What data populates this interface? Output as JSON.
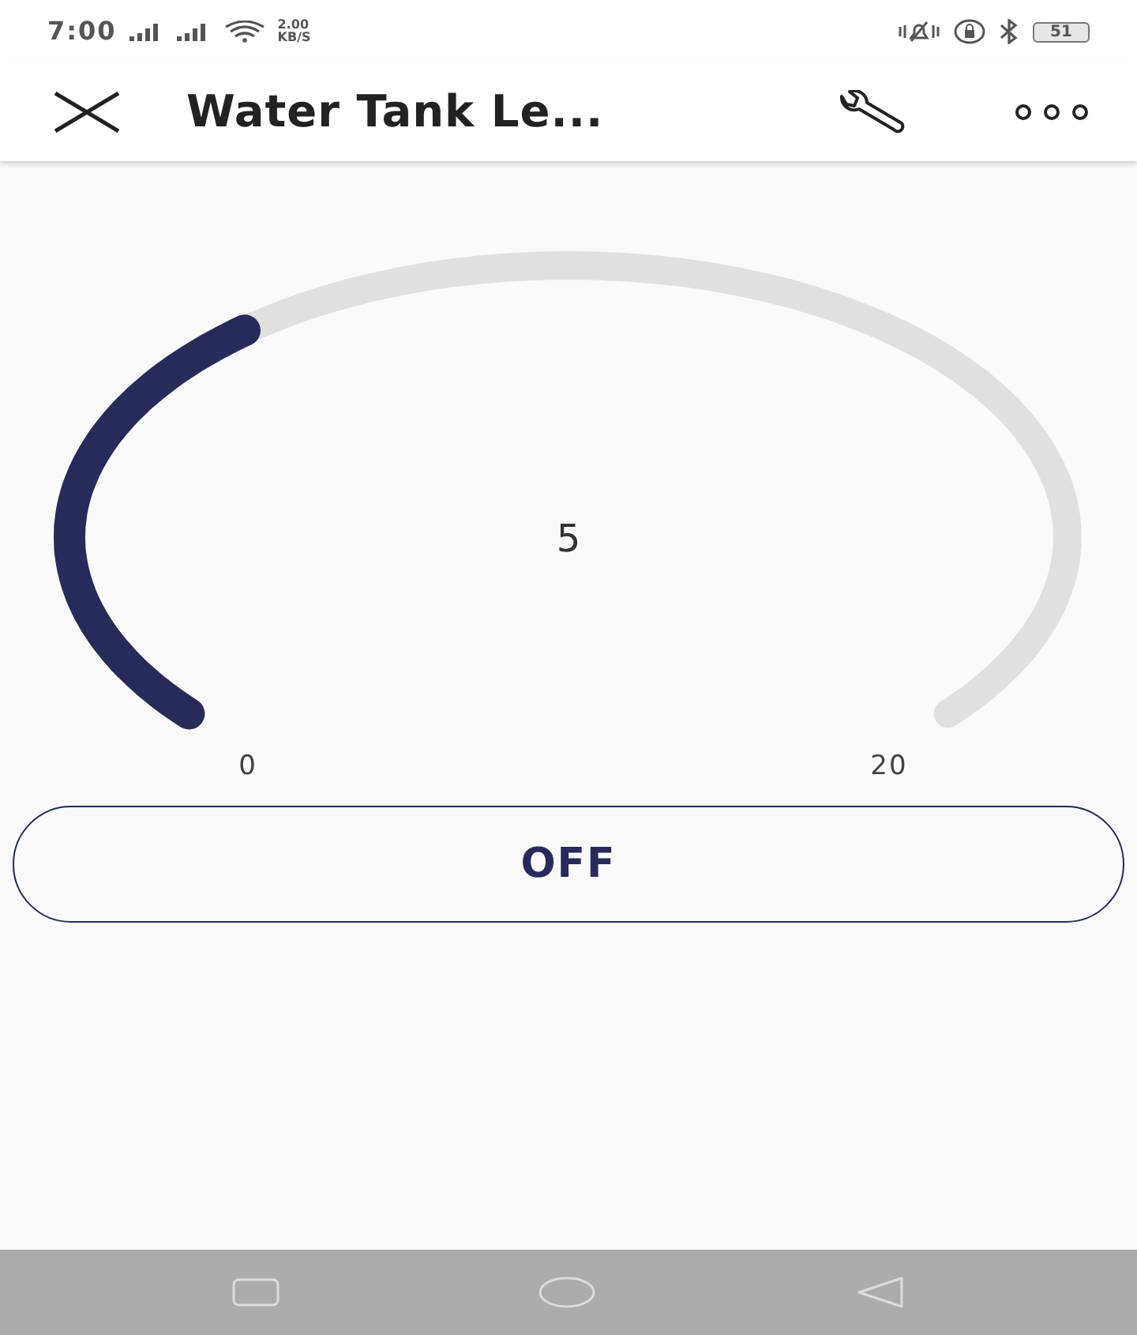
{
  "status_bar": {
    "time": "7:00",
    "speed": "2.00",
    "speed_unit": "KB/S",
    "battery": "51"
  },
  "app_bar": {
    "title": "Water Tank Le..."
  },
  "gauge": {
    "value": "5",
    "min": "0",
    "max": "20"
  },
  "button": {
    "label": "OFF"
  }
}
